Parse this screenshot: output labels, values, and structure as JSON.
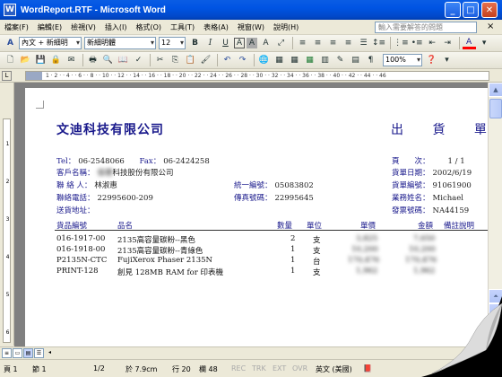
{
  "window": {
    "title": "WordReport.RTF - Microsoft Word",
    "app_icon": "W",
    "buttons": {
      "minimize": "_",
      "maximize": "□",
      "close": "✕"
    }
  },
  "menubar": {
    "items": [
      "檔案(F)",
      "編輯(E)",
      "檢視(V)",
      "插入(I)",
      "格式(O)",
      "工具(T)",
      "表格(A)",
      "視窗(W)",
      "說明(H)"
    ],
    "help_placeholder": "輸入需要解答的問題",
    "close": "×"
  },
  "format_toolbar": {
    "style": "內文 + 新細明",
    "font": "新細明體",
    "size": "12",
    "bold": "B",
    "italic": "I",
    "underline": "U"
  },
  "standard_toolbar": {
    "zoom": "100%"
  },
  "ruler": {
    "ticks": "1 · 2 · · 4 · · 6 · · 8 · · 10 · · 12 · · 14 · · 16 · · 18 · · 20 · · 22 · · 24 · · 26 · · 28 · · 30 · · 32 · · 34 · · 36 · · 38 · · 40 · · 42 · · 44 · · 46"
  },
  "vruler": {
    "numbers": [
      "1",
      "2",
      "3",
      "4",
      "5",
      "6"
    ]
  },
  "document": {
    "company": "文迪科技有限公司",
    "title": "出 貨 單",
    "tel_label": "Tel：",
    "tel": "06-2548066",
    "fax_label": "Fax：",
    "fax": "06-2424258",
    "customer_label": "客戶名稱：",
    "customer_blur": "佳德",
    "customer_suffix": "科技股份有限公司",
    "contact_label": "聯 絡 人：",
    "contact": "林淑惠",
    "taxid_label": "統一編號：",
    "taxid": "05083802",
    "phone_label": "聯絡電話：",
    "phone": "22995600-209",
    "fax2_label": "傳真號碼：",
    "fax2": "22995645",
    "address_label": "送貨地址：",
    "page_label": "頁　　次：",
    "page": "1 / 1",
    "date_label": "貨單日期：",
    "date": "2002/6/19",
    "number_label": "貨單編號：",
    "number": "91061900",
    "sales_label": "業務姓名：",
    "sales": "Michael",
    "invoice_label": "發票號碼：",
    "invoice": "NA44159"
  },
  "table": {
    "headers": [
      "貨品編號",
      "品名",
      "數量",
      "單位",
      "單價",
      "金額",
      "備註說明"
    ],
    "rows": [
      {
        "code": "016-1917-00",
        "name": "2135高容量碳粉--黑色",
        "qty": "2",
        "unit": "支",
        "price": "3,825",
        "amount": "7,650"
      },
      {
        "code": "016-1918-00",
        "name": "2135高容量碳粉--青綠色",
        "qty": "1",
        "unit": "支",
        "price": "10,200",
        "amount": "10,200"
      },
      {
        "code": "P2135N-CTC",
        "name": "FujiXerox Phaser 2135N",
        "qty": "1",
        "unit": "台",
        "price": "170,476",
        "amount": "170,476"
      },
      {
        "code": "PRINT-128",
        "name": "創見 128MB RAM for 印表機",
        "qty": "1",
        "unit": "支",
        "price": "1,962",
        "amount": "1,962"
      }
    ]
  },
  "statusbar": {
    "page": "頁 1",
    "section": "節 1",
    "pages": "1/2",
    "position": "於 7.9cm",
    "line": "行 20",
    "column": "欄 48",
    "rec": "REC",
    "trk": "TRK",
    "ext": "EXT",
    "ovr": "OVR",
    "language": "英文 (美國)"
  }
}
